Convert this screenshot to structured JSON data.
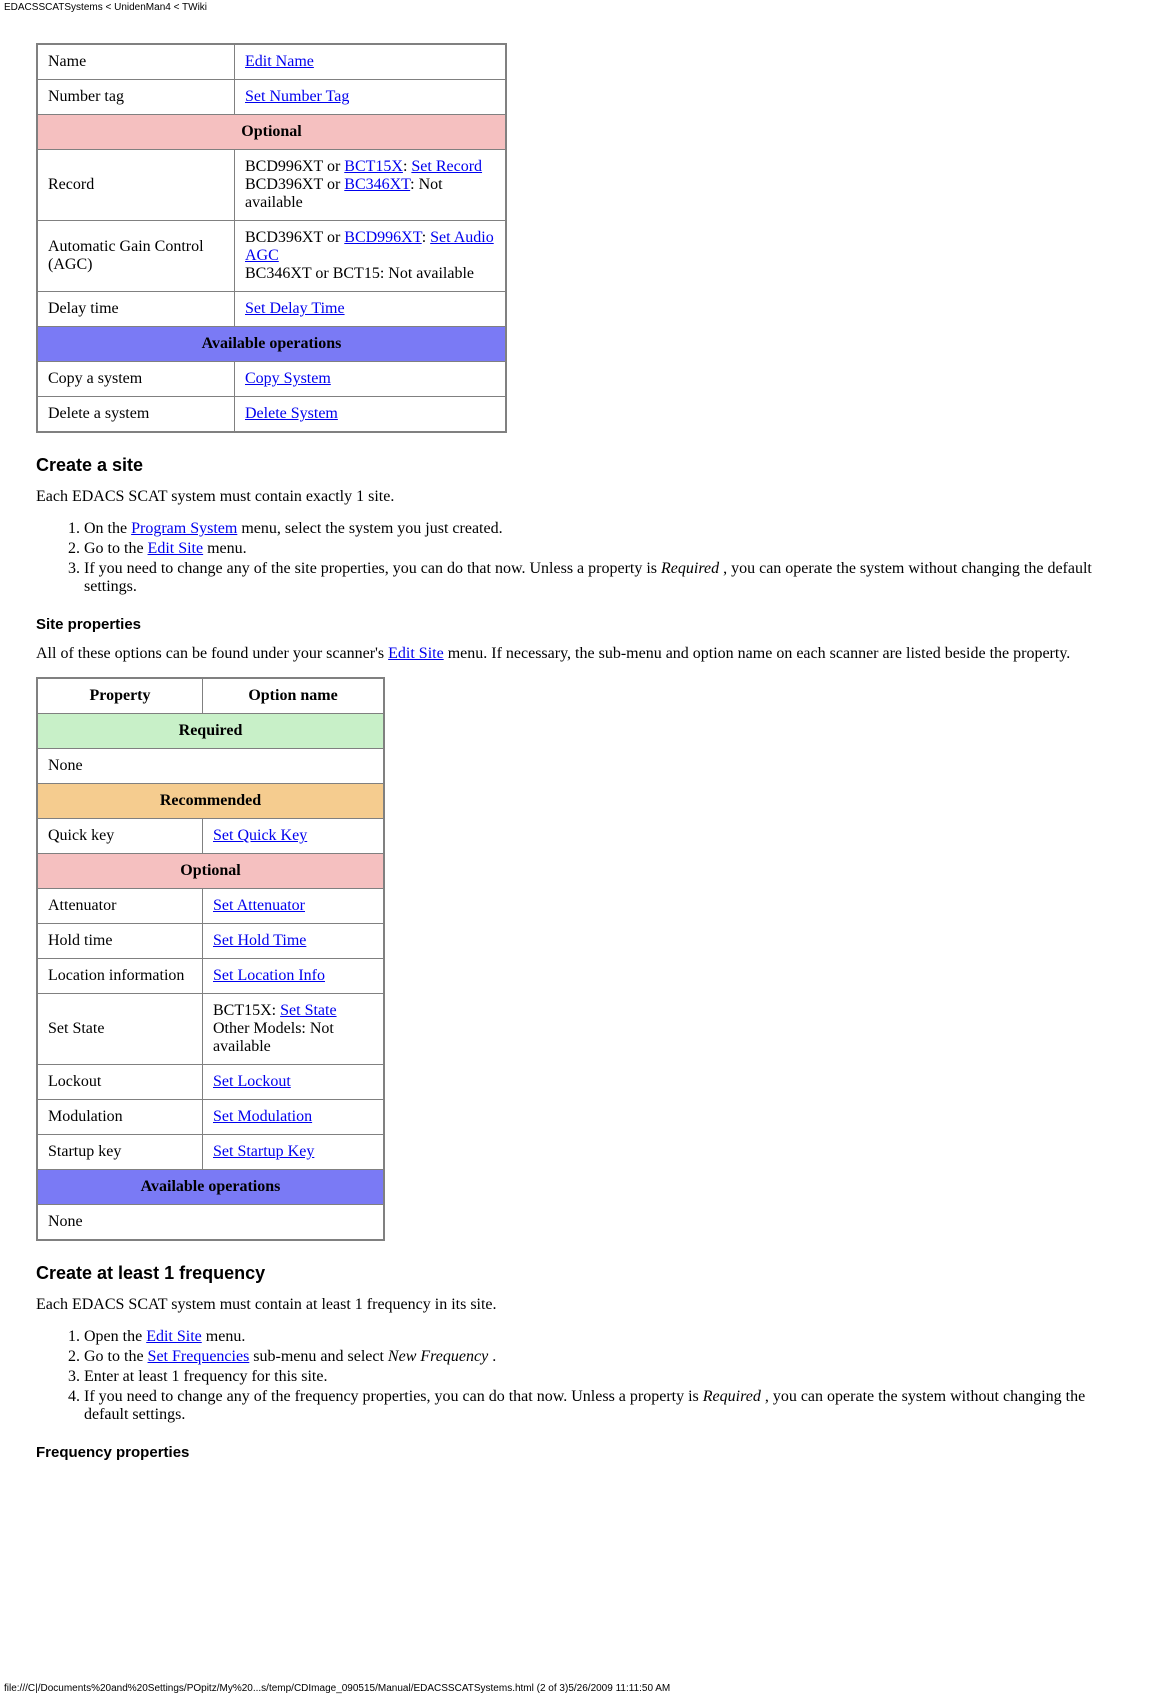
{
  "header_path": "EDACSSCATSystems < UnidenMan4 < TWiki",
  "footer_path": "file:///C|/Documents%20and%20Settings/POpitz/My%20...s/temp/CDImage_090515/Manual/EDACSSCATSystems.html (2 of 3)5/26/2009 11:11:50 AM",
  "table1": {
    "rows": [
      {
        "property": "Name",
        "option_link": "Edit Name"
      },
      {
        "property": "Number tag",
        "option_link": "Set Number Tag"
      }
    ],
    "optional_label": "Optional",
    "optional_rows": [
      {
        "property": "Record",
        "line1_prefix": "BCD996XT or ",
        "line1_link": "BCT15X",
        "line1_mid": ": ",
        "line1_link2": "Set Record",
        "line2_prefix": "BCD396XT or ",
        "line2_link": "BC346XT",
        "line2_suffix": ": Not available"
      },
      {
        "property": "Automatic Gain Control (AGC)",
        "line1_prefix": "BCD396XT or ",
        "line1_link": "BCD996XT",
        "line1_mid": ": ",
        "line1_link2": "Set Audio AGC",
        "line2_plain": "BC346XT or BCT15: Not available"
      },
      {
        "property": "Delay time",
        "option_link": "Set Delay Time"
      }
    ],
    "operations_label": "Available operations",
    "operations_rows": [
      {
        "property": "Copy a system",
        "option_link": "Copy System"
      },
      {
        "property": "Delete a system",
        "option_link": "Delete System"
      }
    ]
  },
  "create_site": {
    "heading": "Create a site",
    "intro": "Each EDACS SCAT system must contain exactly 1 site.",
    "step1_prefix": "On the ",
    "step1_link": "Program System",
    "step1_suffix": " menu, select the system you just created.",
    "step2_prefix": "Go to the ",
    "step2_link": "Edit Site",
    "step2_suffix": " menu.",
    "step3_prefix": "If you need to change any of the site properties, you can do that now. Unless a property is ",
    "step3_em": "Required",
    "step3_suffix": " , you can operate the system without changing the default settings."
  },
  "site_props": {
    "heading": "Site properties",
    "intro_prefix": "All of these options can be found under your scanner's ",
    "intro_link": "Edit Site",
    "intro_suffix": " menu. If necessary, the sub-menu and option name on each scanner are listed beside the property.",
    "col1": "Property",
    "col2": "Option name",
    "required_label": "Required",
    "required_none": "None",
    "recommended_label": "Recommended",
    "recommended_rows": [
      {
        "property": "Quick key",
        "option_link": "Set Quick Key"
      }
    ],
    "optional_label": "Optional",
    "optional_rows": [
      {
        "property": "Attenuator",
        "option_link": "Set Attenuator"
      },
      {
        "property": "Hold time",
        "option_link": "Set Hold Time"
      },
      {
        "property": "Location information",
        "option_link": "Set Location Info"
      },
      {
        "property": "Set State",
        "line1_prefix": "BCT15X: ",
        "line1_link": "Set State",
        "line2_plain": "Other Models: Not available"
      },
      {
        "property": "Lockout",
        "option_link": "Set Lockout"
      },
      {
        "property": "Modulation",
        "option_link": "Set Modulation"
      },
      {
        "property": "Startup key",
        "option_link": "Set Startup Key"
      }
    ],
    "operations_label": "Available operations",
    "operations_none": "None"
  },
  "create_freq": {
    "heading": "Create at least 1 frequency",
    "intro": "Each EDACS SCAT system must contain at least 1 frequency in its site.",
    "step1_prefix": "Open the ",
    "step1_link": "Edit Site",
    "step1_suffix": " menu.",
    "step2_prefix": "Go to the ",
    "step2_link": "Set Frequencies",
    "step2_mid": " sub-menu and select ",
    "step2_em": "New Frequency",
    "step2_suffix": " .",
    "step3": "Enter at least 1 frequency for this site.",
    "step4_prefix": "If you need to change any of the frequency properties, you can do that now. Unless a property is ",
    "step4_em": "Required",
    "step4_suffix": " , you can operate the system without changing the default settings."
  },
  "freq_props_heading": "Frequency properties"
}
